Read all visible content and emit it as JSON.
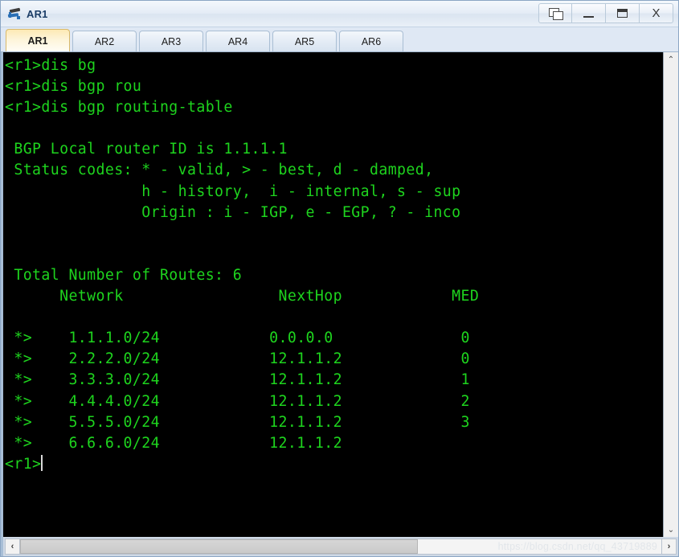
{
  "window": {
    "title": "AR1",
    "icon": "router-icon",
    "buttons": [
      {
        "name": "cascade-windows-button",
        "glyph": "cascade-icon",
        "label": "Cascade"
      },
      {
        "name": "minimize-button",
        "glyph": "minimize-icon",
        "label": "Minimize"
      },
      {
        "name": "maximize-button",
        "glyph": "maximize-icon",
        "label": "Maximize"
      },
      {
        "name": "close-button",
        "glyph": "close-icon",
        "label": "X"
      }
    ]
  },
  "tabs": [
    {
      "label": "AR1",
      "active": true
    },
    {
      "label": "AR2",
      "active": false
    },
    {
      "label": "AR3",
      "active": false
    },
    {
      "label": "AR4",
      "active": false
    },
    {
      "label": "AR5",
      "active": false
    },
    {
      "label": "AR6",
      "active": false
    }
  ],
  "terminal": {
    "foreground_color": "#1ed41e",
    "background_color": "#000000",
    "lines": [
      "<r1>dis bg",
      "<r1>dis bgp rou",
      "<r1>dis bgp routing-table",
      "",
      " BGP Local router ID is 1.1.1.1",
      " Status codes: * - valid, > - best, d - damped,",
      "               h - history,  i - internal, s - sup",
      "               Origin : i - IGP, e - EGP, ? - inco",
      "",
      "",
      " Total Number of Routes: 6",
      "      Network                 NextHop            MED",
      "",
      " *>    1.1.1.0/24            0.0.0.0              0",
      " *>    2.2.2.0/24            12.1.1.2             0",
      " *>    3.3.3.0/24            12.1.1.2             1",
      " *>    4.4.4.0/24            12.1.1.2             2",
      " *>    5.5.5.0/24            12.1.1.2             3",
      " *>    6.6.6.0/24            12.1.1.2",
      "<r1>"
    ],
    "prompt": "<r1>",
    "router_id": "1.1.1.1",
    "total_routes": "6",
    "columns": [
      "Network",
      "NextHop",
      "MED"
    ],
    "routes": [
      {
        "status": "*>",
        "network": "1.1.1.0/24",
        "nexthop": "0.0.0.0",
        "med": "0"
      },
      {
        "status": "*>",
        "network": "2.2.2.0/24",
        "nexthop": "12.1.1.2",
        "med": "0"
      },
      {
        "status": "*>",
        "network": "3.3.3.0/24",
        "nexthop": "12.1.1.2",
        "med": "1"
      },
      {
        "status": "*>",
        "network": "4.4.4.0/24",
        "nexthop": "12.1.1.2",
        "med": "2"
      },
      {
        "status": "*>",
        "network": "5.5.5.0/24",
        "nexthop": "12.1.1.2",
        "med": "3"
      },
      {
        "status": "*>",
        "network": "6.6.6.0/24",
        "nexthop": "12.1.1.2",
        "med": ""
      }
    ]
  },
  "scrollbars": {
    "vertical_up": "⌃",
    "vertical_down": "⌄",
    "horizontal_left": "‹",
    "horizontal_right": "›"
  },
  "watermark": "https://blog.csdn.net/qq_43719889"
}
